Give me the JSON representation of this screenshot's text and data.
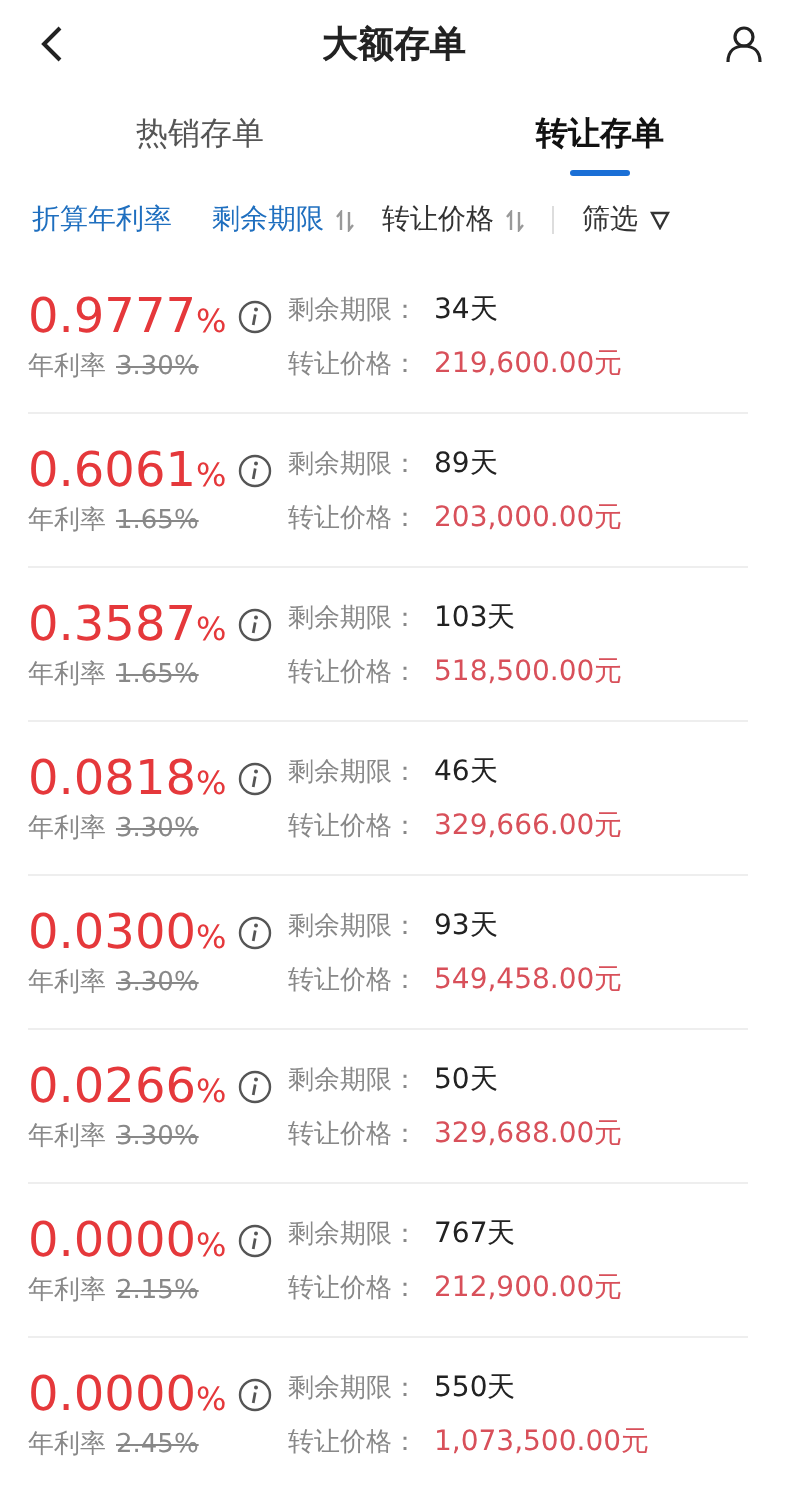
{
  "header": {
    "title": "大额存单"
  },
  "tabs": [
    {
      "label": "热销存单",
      "selected": false
    },
    {
      "label": "转让存单",
      "selected": true
    }
  ],
  "sort_bar": [
    {
      "label": "折算年利率",
      "selected": true,
      "sortable": false
    },
    {
      "label": "剩余期限",
      "selected": true,
      "sortable": true
    },
    {
      "label": "转让价格",
      "selected": false,
      "sortable": true
    }
  ],
  "filter": {
    "label": "筛选"
  },
  "deposits": [
    {
      "rate": "0.9777",
      "unit": "%",
      "base_label": "年利率",
      "base_rate": "3.30%",
      "term_label": "剩余期限：",
      "term": "34天",
      "price_label": "转让价格：",
      "price": "219,600.00元"
    },
    {
      "rate": "0.6061",
      "unit": "%",
      "base_label": "年利率",
      "base_rate": "1.65%",
      "term_label": "剩余期限：",
      "term": "89天",
      "price_label": "转让价格：",
      "price": "203,000.00元"
    },
    {
      "rate": "0.3587",
      "unit": "%",
      "base_label": "年利率",
      "base_rate": "1.65%",
      "term_label": "剩余期限：",
      "term": "103天",
      "price_label": "转让价格：",
      "price": "518,500.00元"
    },
    {
      "rate": "0.0818",
      "unit": "%",
      "base_label": "年利率",
      "base_rate": "3.30%",
      "term_label": "剩余期限：",
      "term": "46天",
      "price_label": "转让价格：",
      "price": "329,666.00元"
    },
    {
      "rate": "0.0300",
      "unit": "%",
      "base_label": "年利率",
      "base_rate": "3.30%",
      "term_label": "剩余期限：",
      "term": "93天",
      "price_label": "转让价格：",
      "price": "549,458.00元"
    },
    {
      "rate": "0.0266",
      "unit": "%",
      "base_label": "年利率",
      "base_rate": "3.30%",
      "term_label": "剩余期限：",
      "term": "50天",
      "price_label": "转让价格：",
      "price": "329,688.00元"
    },
    {
      "rate": "0.0000",
      "unit": "%",
      "base_label": "年利率",
      "base_rate": "2.15%",
      "term_label": "剩余期限：",
      "term": "767天",
      "price_label": "转让价格：",
      "price": "212,900.00元"
    },
    {
      "rate": "0.0000",
      "unit": "%",
      "base_label": "年利率",
      "base_rate": "2.45%",
      "term_label": "剩余期限：",
      "term": "550天",
      "price_label": "转让价格：",
      "price": "1,073,500.00元"
    }
  ]
}
